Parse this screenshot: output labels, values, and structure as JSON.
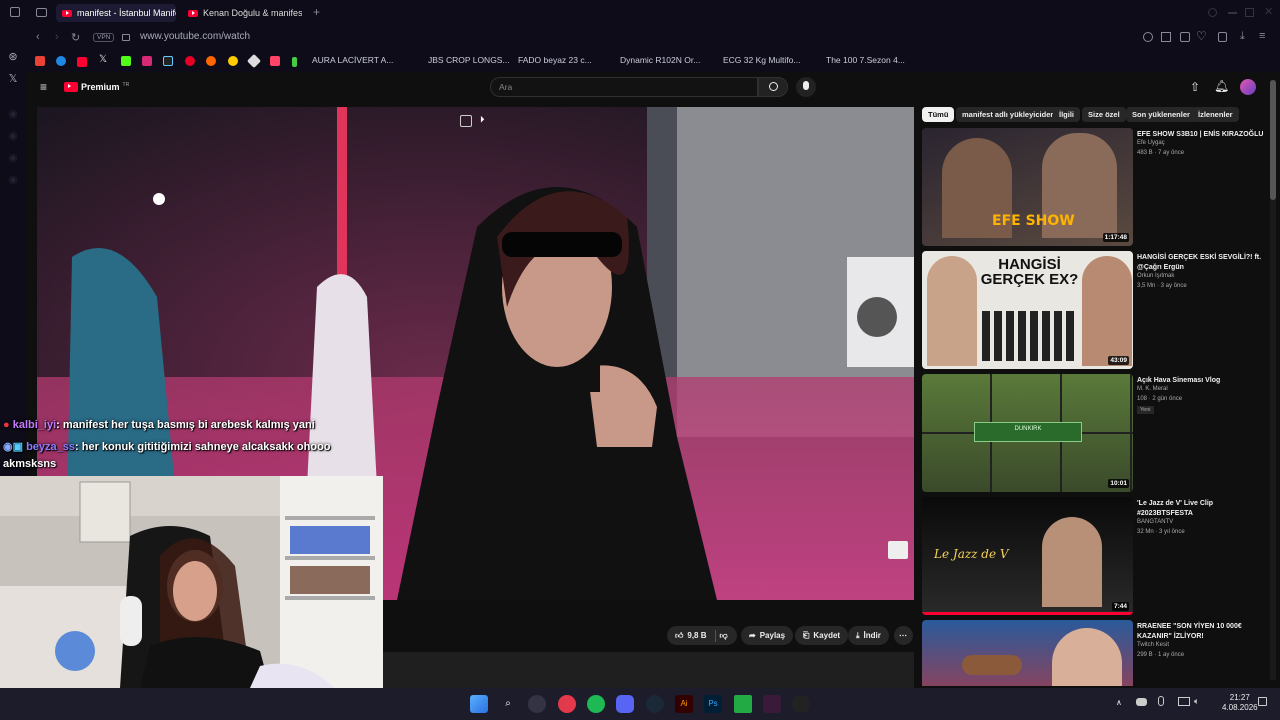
{
  "browser": {
    "tabs": [
      {
        "label": "manifest - İstanbul Manifes"
      },
      {
        "label": "Kenan Doğulu & manifest"
      }
    ],
    "url": "www.youtube.com/watch",
    "vpn_label": "VPN",
    "bookmarks": [
      {
        "label": "AURA LACİVERT A..."
      },
      {
        "label": "JBS CROP LONGS..."
      },
      {
        "label": "FADO beyaz 23 c..."
      },
      {
        "label": "Dynamic R102N Or..."
      },
      {
        "label": "ECG 32 Kg Multifo..."
      },
      {
        "label": "The 100 7.Sezon 4..."
      }
    ]
  },
  "youtube": {
    "logo_text": "Premium",
    "logo_sup": "TR",
    "search_placeholder": "Ara",
    "actions": {
      "likes": "9,8 B",
      "share": "Paylaş",
      "save": "Kaydet",
      "download": "İndir"
    },
    "chips": [
      "Tümü",
      "manifest adlı yükleyiciden",
      "İlgili",
      "Size özel",
      "Son yüklenenler",
      "İzlenenler"
    ],
    "recommendations": [
      {
        "title": "EFE SHOW S3B10 | ENİS KIRAZOĞLU",
        "channel": "Efe Uygaç",
        "meta": "483 B · 7 ay önce",
        "duration": "1:17:48",
        "thumb_text": "EFE SHOW"
      },
      {
        "title": "HANGİSİ GERÇEK ESKİ SEVGİLİ?! ft. @Çağrı Ergün",
        "channel": "Orkun Işıtmak",
        "meta": "3,5 Mn · 3 ay önce",
        "duration": "43:09",
        "thumb_text": "HANGİSİ GERÇEK EX?"
      },
      {
        "title": "Açık Hava Sineması Vlog",
        "channel": "M. K. Meral",
        "meta": "108 · 2 gün önce",
        "duration": "10:01",
        "badge": "Yeni",
        "thumb_text": "DUNKIRK"
      },
      {
        "title": "'Le Jazz de V' Live Clip #2023BTSFESTA",
        "channel": "BANGTANTV",
        "meta": "32 Mn · 3 yıl önce",
        "duration": "7:44",
        "thumb_text": "Le Jazz de V"
      },
      {
        "title": "RRAENEE \"SON YİYEN 10 000€ KAZANIR\" İZLİYOR!",
        "channel": "Twitch Kesit",
        "meta": "299 B · 1 ay önce",
        "duration": "",
        "thumb_text": ""
      }
    ]
  },
  "chat": [
    {
      "user": "kalbi_iyi",
      "message": ": manifest her tuşa basmış bi arebesk kalmış yani",
      "color": "#c47bff"
    },
    {
      "user": "beyza_ss",
      "message": ": her konuk gititiğimizi sahneye alcaksakk ohooo",
      "color": "#8a7dff",
      "continuation": "akmsksns"
    }
  ],
  "taskbar": {
    "time": "21:27",
    "date": "4.08.2026"
  },
  "colors": {
    "yt_red": "#ff0033",
    "browser_bg": "#0d0c18"
  }
}
